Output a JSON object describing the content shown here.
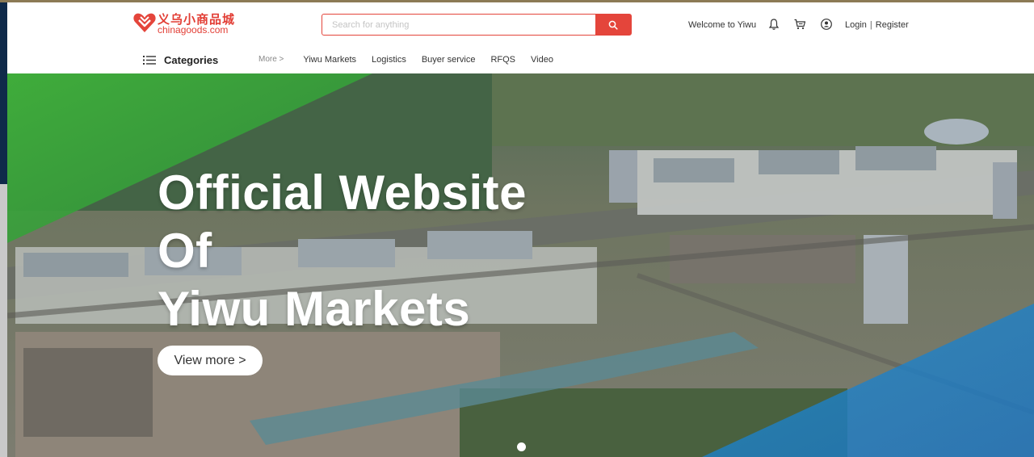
{
  "header": {
    "logo_cn": "义乌小商品城",
    "logo_en": "chinagoods.com",
    "search_placeholder": "Search for anything",
    "welcome": "Welcome to Yiwu",
    "login": "Login",
    "separator": "|",
    "register": "Register"
  },
  "nav": {
    "categories_label": "Categories",
    "more": "More >",
    "items": [
      "Yiwu Markets",
      "Logistics",
      "Buyer service",
      "RFQS",
      "Video"
    ]
  },
  "hero": {
    "title_line1": "Official Website",
    "title_line2": "Of",
    "title_line3": "Yiwu Markets",
    "button": "View more >"
  },
  "colors": {
    "brand_red": "#e4453b",
    "green_overlay": "#3fae3a",
    "blue_overlay": "#1e8fd6"
  },
  "icons": [
    "search-icon",
    "bell-icon",
    "cart-icon",
    "user-icon",
    "menu-icon"
  ]
}
